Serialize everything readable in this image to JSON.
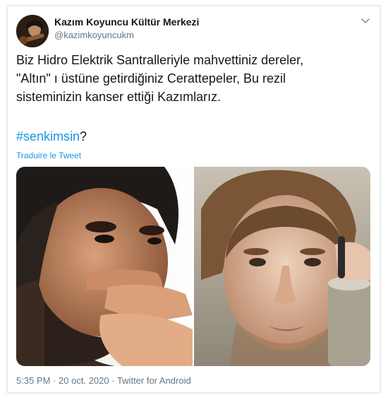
{
  "account": {
    "display_name": "Kazım Koyuncu Kültür Merkezi",
    "handle": "@kazimkoyuncukm"
  },
  "tweet": {
    "lines": [
      "Biz Hidro Elektrik Santralleriyle mahvettiniz dereler,",
      "\"Altın\" ı üstüne getirdiğiniz Cerattepeler, Bu rezil",
      "sisteminizin kanser ettiği Kazımlarız."
    ],
    "hashtag": "#senkimsin",
    "hashtag_suffix": "?",
    "translate_label": "Traduire le Tweet"
  },
  "meta": {
    "time": "5:35 PM",
    "separator": "·",
    "date": "20 oct. 2020",
    "source": "Twitter for Android"
  },
  "icons": {
    "menu": "chevron-down-icon"
  },
  "colors": {
    "link": "#1b95e0",
    "text": "#14171a",
    "muted": "#657786"
  }
}
